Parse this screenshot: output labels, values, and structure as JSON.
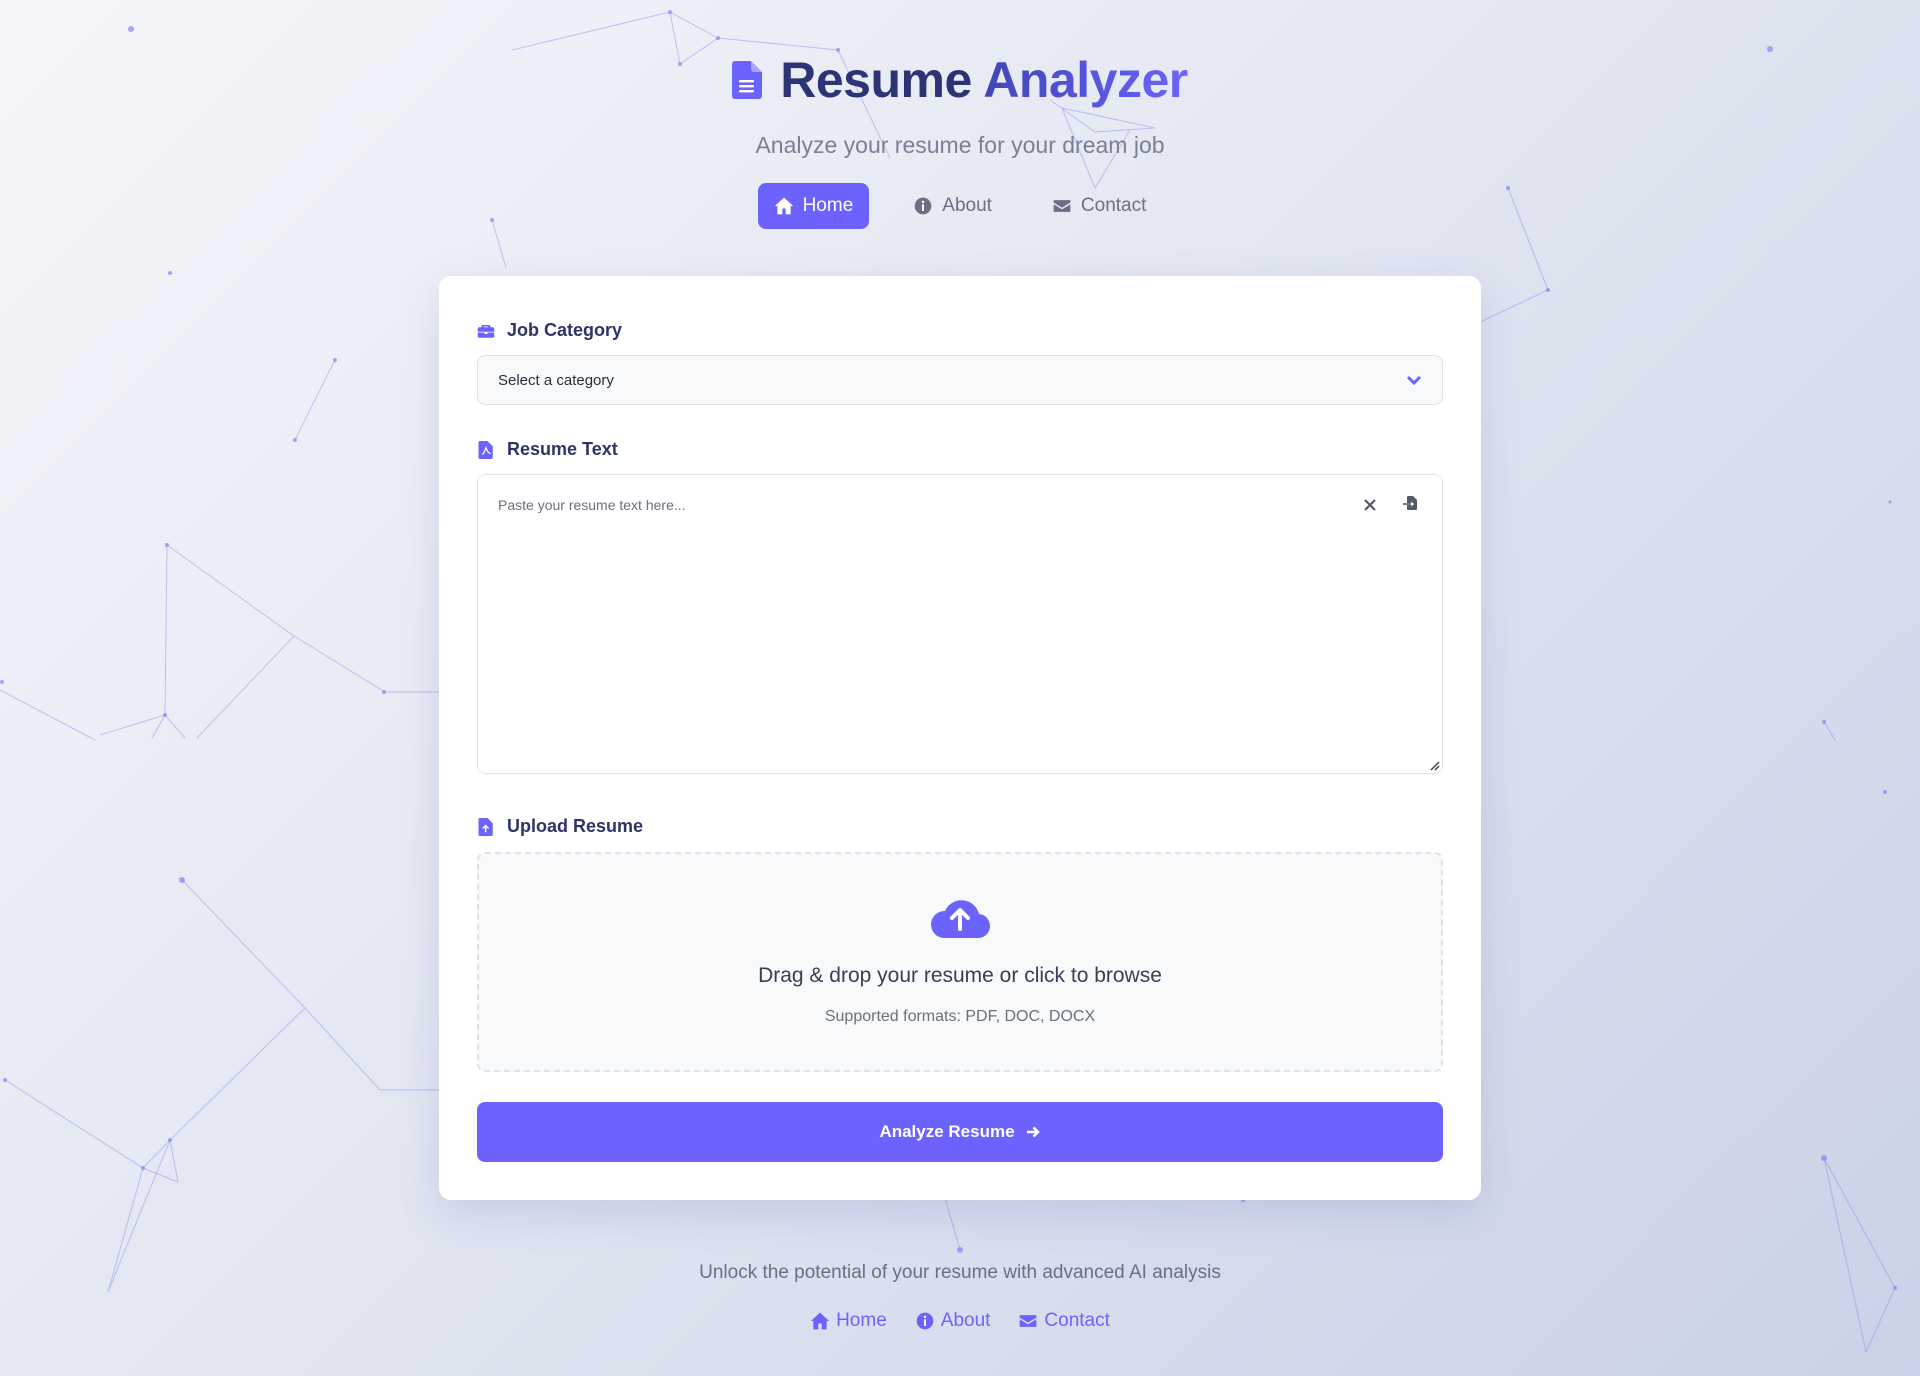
{
  "header": {
    "title_part1": "Resume",
    "title_part2": "Analyzer",
    "subtitle": "Analyze your resume for your dream job",
    "icon": "file-lines-icon"
  },
  "nav": {
    "items": [
      {
        "label": "Home",
        "icon": "home-icon",
        "active": true
      },
      {
        "label": "About",
        "icon": "info-circle-icon",
        "active": false
      },
      {
        "label": "Contact",
        "icon": "envelope-icon",
        "active": false
      }
    ]
  },
  "form": {
    "job_category": {
      "label": "Job Category",
      "icon": "briefcase-icon",
      "selected": "Select a category"
    },
    "resume_text": {
      "label": "Resume Text",
      "icon": "file-pdf-icon",
      "placeholder": "Paste your resume text here...",
      "value": ""
    },
    "upload": {
      "label": "Upload Resume",
      "icon": "file-upload-icon",
      "main_text": "Drag & drop your resume or click to browse",
      "sub_text": "Supported formats: PDF, DOC, DOCX"
    },
    "submit_label": "Analyze Resume"
  },
  "footer": {
    "text": "Unlock the potential of your resume with advanced AI analysis",
    "links": [
      {
        "label": "Home",
        "icon": "home-icon"
      },
      {
        "label": "About",
        "icon": "info-circle-icon"
      },
      {
        "label": "Contact",
        "icon": "envelope-icon"
      }
    ]
  },
  "colors": {
    "accent": "#6c63ff",
    "title_dark": "#2b3475",
    "label": "#2d3566",
    "muted": "#6a6f86"
  }
}
